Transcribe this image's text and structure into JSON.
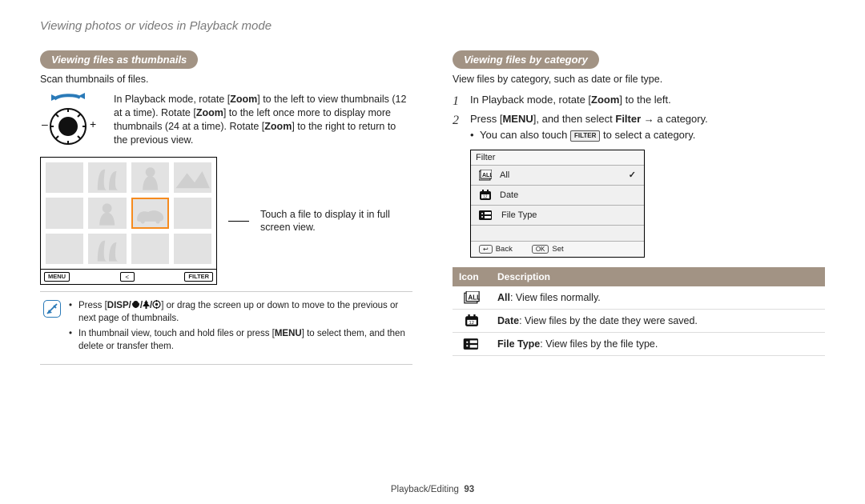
{
  "page_title": "Viewing photos or videos in Playback mode",
  "left": {
    "heading": "Viewing files as thumbnails",
    "caption": "Scan thumbnails of files.",
    "dial_text_pre": "In Playback mode, rotate [",
    "dial_zoom": "Zoom",
    "dial_text_1": "] to the left to view thumbnails (12 at a time). Rotate [",
    "dial_text_2": "] to the left once more to display more thumbnails (24 at a time). Rotate [",
    "dial_text_3": "] to the right to return to the previous view.",
    "lcd_menu": "MENU",
    "lcd_filter": "FILTER",
    "callout": "Touch a file to display it in full screen view.",
    "note1_pre": "Press [",
    "note1_keys": "DISP",
    "note1_mid": "] or drag the screen up or down to move to the previous or next page of thumbnails.",
    "note2_pre": "In thumbnail view, touch and hold files or press [",
    "note2_key": "MENU",
    "note2_post": "] to select them, and then delete or transfer them."
  },
  "right": {
    "heading": "Viewing files by category",
    "caption": "View files by category, such as date or file type.",
    "step1_pre": "In Playback mode, rotate [",
    "step1_zoom": "Zoom",
    "step1_post": "] to the left.",
    "step2_pre": "Press [",
    "step2_menu": "MENU",
    "step2_mid": "], and then select ",
    "step2_filter": "Filter",
    "step2_arrow": " → a category.",
    "sub_pre": "You can also touch ",
    "sub_btn": "FILTER",
    "sub_post": " to select a category.",
    "filter_title": "Filter",
    "filter_items": {
      "all": "All",
      "date": "Date",
      "ftype": "File Type"
    },
    "filter_back": "Back",
    "filter_set": "Set",
    "filter_ok": "OK",
    "th_icon": "Icon",
    "th_desc": "Description",
    "row_all_b": "All",
    "row_all_t": ": View files normally.",
    "row_date_b": "Date",
    "row_date_t": ": View files by the date they were saved.",
    "row_ft_b": "File Type",
    "row_ft_t": ": View files by the file type."
  },
  "footer": {
    "section": "Playback/Editing",
    "page": "93"
  }
}
